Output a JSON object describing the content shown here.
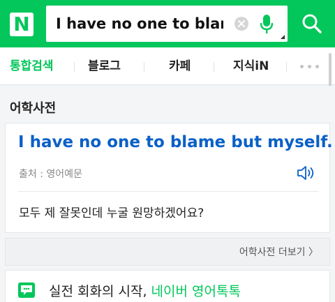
{
  "header": {
    "logo_text": "N",
    "search": {
      "value": "I have no one to blame"
    }
  },
  "tabs": [
    {
      "label": "통합검색",
      "active": true
    },
    {
      "label": "블로그",
      "active": false
    },
    {
      "label": "카페",
      "active": false
    },
    {
      "label": "지식iN",
      "active": false
    }
  ],
  "dictionary": {
    "section_title": "어학사전",
    "sentence_main": "I have no one to blame but myself",
    "sentence_end": ".",
    "source": "출처 : 영어예문",
    "translation": "모두 제 잘못인데 누굴 원망하겠어요?",
    "more_link": "어학사전 더보기",
    "more_arrow": "〉"
  },
  "promo": {
    "text_prefix": "실전 회화의 시작, ",
    "text_brand": "네이버 영어톡톡"
  },
  "colors": {
    "brand_green": "#03c75a",
    "link_blue": "#0a60c7"
  }
}
